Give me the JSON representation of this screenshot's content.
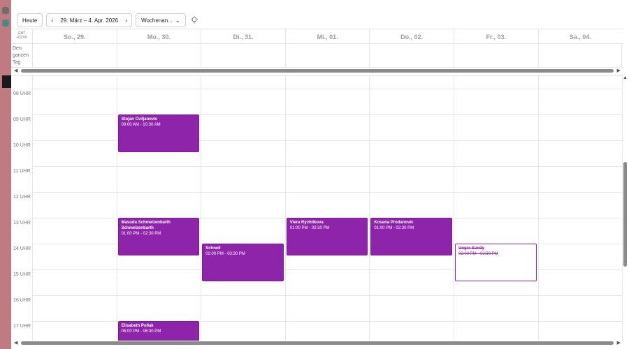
{
  "toolbar": {
    "today_label": "Heute",
    "prev_icon": "‹",
    "next_icon": "›",
    "date_range": "29. März – 4. Apr. 2026",
    "view_label": "Wochenan...",
    "view_chevron": "⌄"
  },
  "timezone": {
    "line1": "GMT",
    "line2": "+02:00"
  },
  "days": [
    {
      "label": "So., 29."
    },
    {
      "label": "Mo., 30."
    },
    {
      "label": "Di., 31."
    },
    {
      "label": "Mi., 01."
    },
    {
      "label": "Do., 02."
    },
    {
      "label": "Fr., 03."
    },
    {
      "label": "Sa., 04."
    }
  ],
  "allday_label": "Den ganzen Tag",
  "hours": [
    "08 UHR",
    "09 UHR",
    "10 UHR",
    "11 UHR",
    "12 UHR",
    "13 UHR",
    "14 UHR",
    "15 UHR",
    "16 UHR",
    "17 UHR"
  ],
  "events": [
    {
      "day": 1,
      "start": 9.0,
      "end": 10.5,
      "title": "Stojan Cviljanovic",
      "title2": "",
      "time": "09:00 AM - 10:30 AM",
      "cancelled": false
    },
    {
      "day": 1,
      "start": 13.0,
      "end": 14.5,
      "title": "Masuda Schmelzenbarth",
      "title2": "Schmelzenbarth",
      "time": "01:00 PM - 02:30 PM",
      "cancelled": false
    },
    {
      "day": 2,
      "start": 14.0,
      "end": 15.5,
      "title": "Schnell",
      "title2": "",
      "time": "02:00 PM - 03:30 PM",
      "cancelled": false
    },
    {
      "day": 3,
      "start": 13.0,
      "end": 14.5,
      "title": "Viera Rychlikova",
      "title2": "",
      "time": "01:00 PM - 02:30 PM",
      "cancelled": false
    },
    {
      "day": 4,
      "start": 13.0,
      "end": 14.5,
      "title": "Kosana Prodanovic",
      "title2": "",
      "time": "01:00 PM - 02:30 PM",
      "cancelled": false
    },
    {
      "day": 5,
      "start": 14.0,
      "end": 15.5,
      "title": "Unger Sandy",
      "title2": "",
      "time": "02:00 PM - 03:30 PM",
      "cancelled": true
    },
    {
      "day": 1,
      "start": 17.0,
      "end": 18.5,
      "title": "Elisabeth Pollak",
      "title2": "",
      "time": "05:00 PM - 06:30 PM",
      "cancelled": false
    }
  ],
  "colors": {
    "event": "#8e24aa",
    "strip": "#c07a82"
  }
}
